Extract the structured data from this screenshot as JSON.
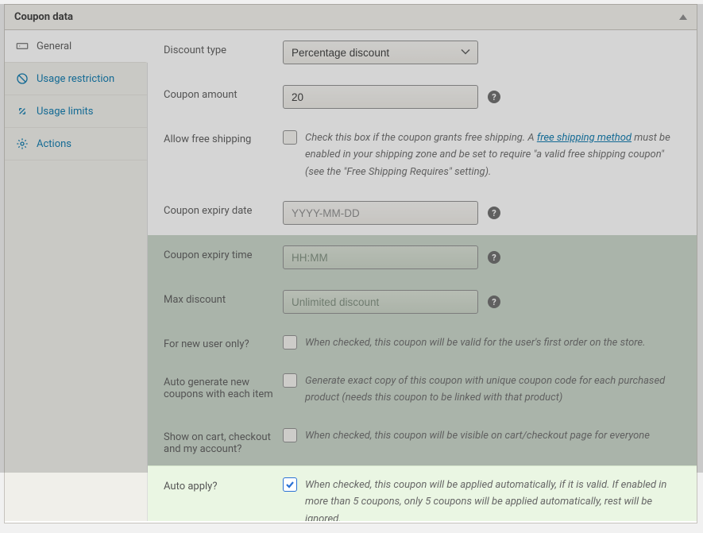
{
  "panel_title": "Coupon data",
  "sidebar": {
    "items": [
      {
        "label": "General",
        "icon": "ticket-icon"
      },
      {
        "label": "Usage restriction",
        "icon": "ban-icon"
      },
      {
        "label": "Usage limits",
        "icon": "resize-icon"
      },
      {
        "label": "Actions",
        "icon": "gear-icon"
      }
    ]
  },
  "fields": {
    "discount_type": {
      "label": "Discount type",
      "value": "Percentage discount"
    },
    "coupon_amount": {
      "label": "Coupon amount",
      "value": "20"
    },
    "free_shipping": {
      "label": "Allow free shipping",
      "desc_pre": "Check this box if the coupon grants free shipping. A ",
      "link": "free shipping method",
      "desc_post": " must be enabled in your shipping zone and be set to require \"a valid free shipping coupon\" (see the \"Free Shipping Requires\" setting)."
    },
    "expiry_date": {
      "label": "Coupon expiry date",
      "placeholder": "YYYY-MM-DD"
    },
    "expiry_time": {
      "label": "Coupon expiry time",
      "placeholder": "HH:MM"
    },
    "max_discount": {
      "label": "Max discount",
      "placeholder": "Unlimited discount"
    },
    "new_user": {
      "label": "For new user only?",
      "desc": "When checked, this coupon will be valid for the user's first order on the store."
    },
    "auto_generate": {
      "label": "Auto generate new coupons with each item",
      "desc": "Generate exact copy of this coupon with unique coupon code for each purchased product (needs this coupon to be linked with that product)"
    },
    "show_on": {
      "label": "Show on cart, checkout and my account?",
      "desc": "When checked, this coupon will be visible on cart/checkout page for everyone"
    },
    "auto_apply": {
      "label": "Auto apply?",
      "checked": true,
      "desc": "When checked, this coupon will be applied automatically, if it is valid. If enabled in more than 5 coupons, only 5 coupons will be applied automatically, rest will be ignored."
    }
  }
}
